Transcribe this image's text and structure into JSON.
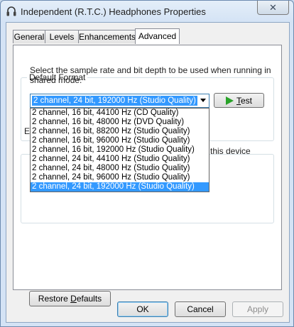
{
  "window": {
    "title": "Independent (R.T.C.) Headphones Properties",
    "close_glyph": "✕"
  },
  "tabs": [
    {
      "label": "General"
    },
    {
      "label": "Levels"
    },
    {
      "label": "Enhancements"
    },
    {
      "label": "Advanced",
      "active": true
    }
  ],
  "default_format": {
    "group_title": "Default Format",
    "description": "Select the sample rate and bit depth to be used when running in shared mode.",
    "selected": "2 channel, 24 bit, 192000 Hz (Studio Quality)",
    "test_button": {
      "prefix": "",
      "accel": "T",
      "suffix": "est"
    },
    "options": [
      "2 channel, 16 bit, 44100 Hz (CD Quality)",
      "2 channel, 16 bit, 48000 Hz (DVD Quality)",
      "2 channel, 16 bit, 88200 Hz (Studio Quality)",
      "2 channel, 16 bit, 96000 Hz (Studio Quality)",
      "2 channel, 16 bit, 192000 Hz (Studio Quality)",
      "2 channel, 24 bit, 44100 Hz (Studio Quality)",
      "2 channel, 24 bit, 48000 Hz (Studio Quality)",
      "2 channel, 24 bit, 96000 Hz (Studio Quality)",
      "2 channel, 24 bit, 192000 Hz (Studio Quality)"
    ],
    "selected_index": 8
  },
  "exclusive_mode": {
    "group_title_fragment": "E",
    "text_fragment": "this device"
  },
  "restore_button": {
    "prefix": "Restore ",
    "accel": "D",
    "suffix": "efaults"
  },
  "footer": {
    "ok": "OK",
    "cancel": "Cancel",
    "apply": "Apply"
  },
  "colors": {
    "selection": "#3399ff",
    "play_icon": "#29a329"
  }
}
